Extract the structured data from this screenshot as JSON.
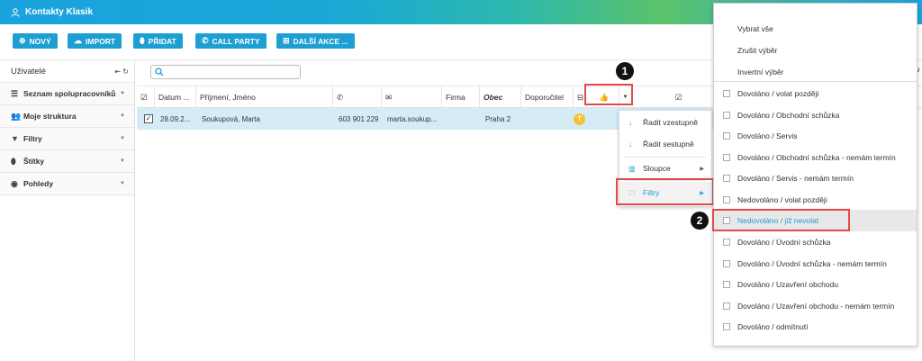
{
  "window": {
    "title": "Kontakty Klasik",
    "close_glyph": "×"
  },
  "toolbar": {
    "buttons": [
      {
        "label": "NOVÝ",
        "icon": "plus-circle-icon",
        "glyph": "⊕"
      },
      {
        "label": "IMPORT",
        "icon": "cloud-upload-icon",
        "glyph": "☁"
      },
      {
        "label": "PŘIDAT",
        "icon": "tag-icon",
        "glyph": "⬮"
      },
      {
        "label": "CALL PARTY",
        "icon": "phone-icon",
        "glyph": "✆"
      },
      {
        "label": "DALŠÍ AKCE ...",
        "icon": "plus-square-icon",
        "glyph": "⊞"
      }
    ]
  },
  "sidebar": {
    "header": "Uživatelé",
    "controls": "⇤ ↻",
    "items": [
      {
        "label": "Seznam spolupracovníků",
        "glyph": "☰"
      },
      {
        "label": "Moje struktura",
        "glyph": "👥"
      },
      {
        "label": "Filtry",
        "glyph": "▼"
      },
      {
        "label": "Štítky",
        "glyph": "⬮"
      },
      {
        "label": "Pohledy",
        "glyph": "◉"
      }
    ]
  },
  "table": {
    "columns": {
      "date": "Datum ...",
      "name": "Příjmení, Jméno",
      "firm": "Firma",
      "city": "Obec",
      "referrer": "Doporučitel"
    },
    "row": {
      "date": "28.09.2...",
      "name": "Soukupová, Marta",
      "phone": "603 901 229",
      "email": "marta.soukup...",
      "city": "Praha 2",
      "badge": "T"
    }
  },
  "context_menu": {
    "items": [
      {
        "label": "Řadit vzestupně",
        "glyph": "↓"
      },
      {
        "label": "Řadit sestupně",
        "glyph": "↓"
      },
      {
        "label": "Sloupce",
        "glyph": "▥"
      },
      {
        "label": "Filtry",
        "glyph": "☐"
      }
    ]
  },
  "filter_panel": {
    "top": [
      "Vybrat vše",
      "Zrušit výběr",
      "Invertní výběr"
    ],
    "options": [
      "Dovoláno / volat později",
      "Dovoláno / Obchodní schůzka",
      "Dovoláno / Servis",
      "Dovoláno / Obchodní schůzka - nemám termín",
      "Dovoláno / Servis - nemám termín",
      "Nedovoláno / volat později",
      "Nedovoláno / již nevolat",
      "Dovoláno / Úvodní schůzka",
      "Dovoláno / Úvodní schůzka - nemám termín",
      "Dovoláno / Uzavření obchodu",
      "Dovoláno / Uzavření obchodu - nemám termín",
      "Dovoláno / odmítnutí"
    ],
    "highlighted_index": 6
  },
  "markers": [
    "1",
    "2"
  ],
  "colors": {
    "accent": "#1e9fd3",
    "highlight_row": "#d5ecf7",
    "annotation_red": "#e24a4a",
    "badge_yellow": "#f4c430"
  }
}
